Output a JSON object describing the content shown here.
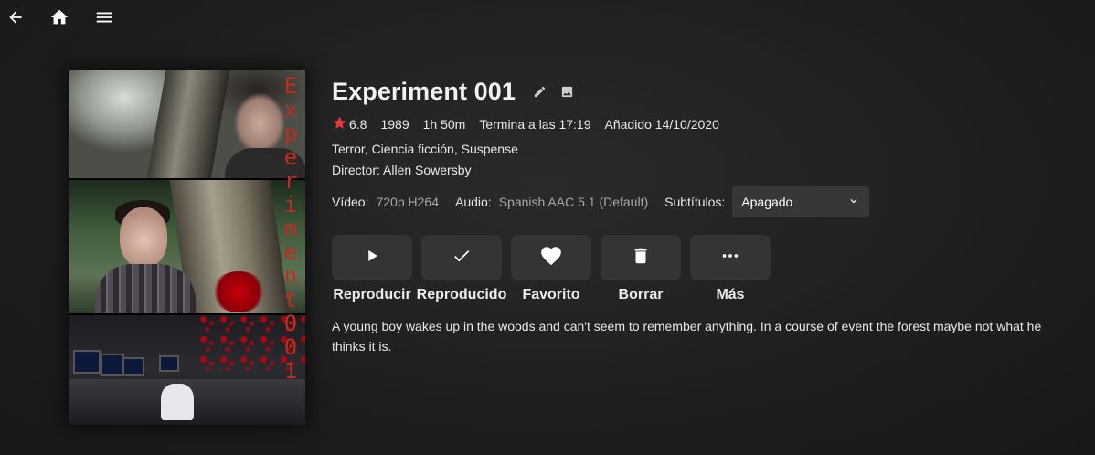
{
  "topbar": {
    "icons": [
      "back-arrow-icon",
      "home-icon",
      "menu-icon"
    ]
  },
  "poster": {
    "vertical_title": "Experiment001"
  },
  "item": {
    "title": "Experiment 001",
    "rating": "6.8",
    "year": "1989",
    "runtime": "1h 50m",
    "ends_at": "Termina a las 17:19",
    "added": "Añadido 14/10/2020",
    "genres": "Terror, Ciencia ficción, Suspense",
    "director": "Director: Allen Sowersby",
    "overview": "A young boy wakes up in the woods and can't seem to remember anything. In a course of event the forest maybe not what he thinks it is."
  },
  "streams": {
    "video_label": "Vídeo:",
    "video_value": "720p H264",
    "audio_label": "Audio:",
    "audio_value": "Spanish AAC 5.1 (Default)",
    "subtitles_label": "Subtítulos:",
    "subtitles_value": "Apagado"
  },
  "actions": [
    {
      "label": "Reproducir",
      "icon": "play-icon"
    },
    {
      "label": "Reproducido",
      "icon": "check-icon"
    },
    {
      "label": "Favorito",
      "icon": "heart-icon"
    },
    {
      "label": "Borrar",
      "icon": "trash-icon"
    },
    {
      "label": "Más",
      "icon": "more-icon"
    }
  ],
  "colors": {
    "background": "#1e1e1e",
    "button": "#343434",
    "rating_star": "#e53935",
    "poster_title": "#c6291e"
  }
}
